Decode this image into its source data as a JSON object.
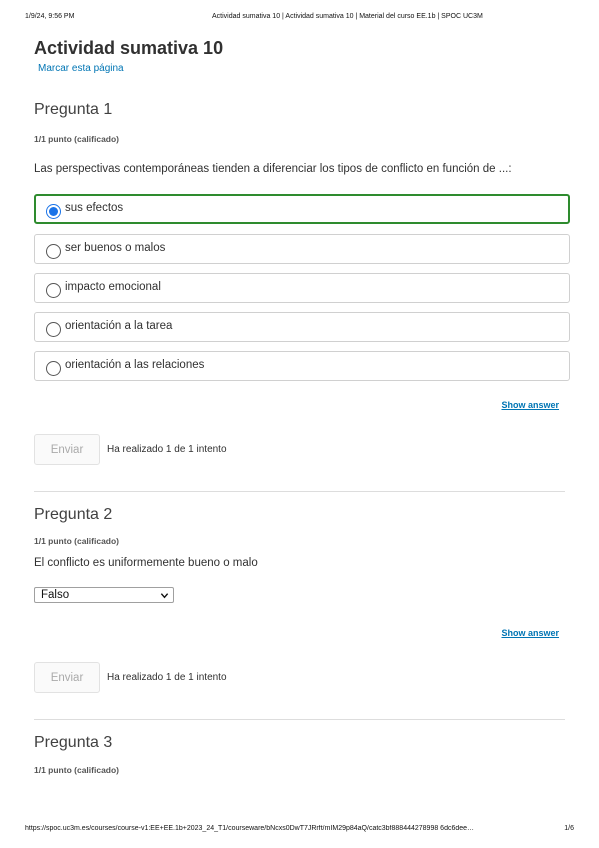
{
  "print": {
    "date": "1/9/24, 9:56 PM",
    "title": "Actividad sumativa 10 | Actividad sumativa 10 | Material del curso EE.1b | SPOC UC3M",
    "url": "https://spoc.uc3m.es/courses/course-v1:EE+EE.1b+2023_24_T1/courseware/bNcxs0DwT7JRrft/mIM29p84aQ/catc3bf888444278998 6dc6dee…",
    "page": "1/6"
  },
  "page": {
    "title": "Actividad sumativa 10",
    "bookmark": "Marcar esta página"
  },
  "questions": [
    {
      "title": "Pregunta 1",
      "points": "1/1 punto (calificado)",
      "prompt": "Las perspectivas contemporáneas tienden a diferenciar los tipos de conflicto en función de ...:",
      "options": [
        {
          "label": "sus efectos",
          "selected": true
        },
        {
          "label": "ser buenos o malos",
          "selected": false
        },
        {
          "label": "impacto emocional",
          "selected": false
        },
        {
          "label": "orientación a la tarea",
          "selected": false
        },
        {
          "label": "orientación a las relaciones",
          "selected": false
        }
      ],
      "show_answer": "Show answer",
      "submit": "Enviar",
      "attempts": "Ha realizado 1 de 1 intento"
    },
    {
      "title": "Pregunta 2",
      "points": "1/1 punto (calificado)",
      "prompt": "El conflicto es uniformemente bueno o malo",
      "selected_value": "Falso",
      "show_answer": "Show answer",
      "submit": "Enviar",
      "attempts": "Ha realizado 1 de 1 intento"
    },
    {
      "title": "Pregunta 3",
      "points": "1/1 punto (calificado)"
    }
  ],
  "colors": {
    "link": "#0075b4",
    "selected_border": "#2e8b2e",
    "radio_checked": "#1a73e8"
  },
  "icons": {
    "select_arrow": "chevron-down-icon"
  }
}
